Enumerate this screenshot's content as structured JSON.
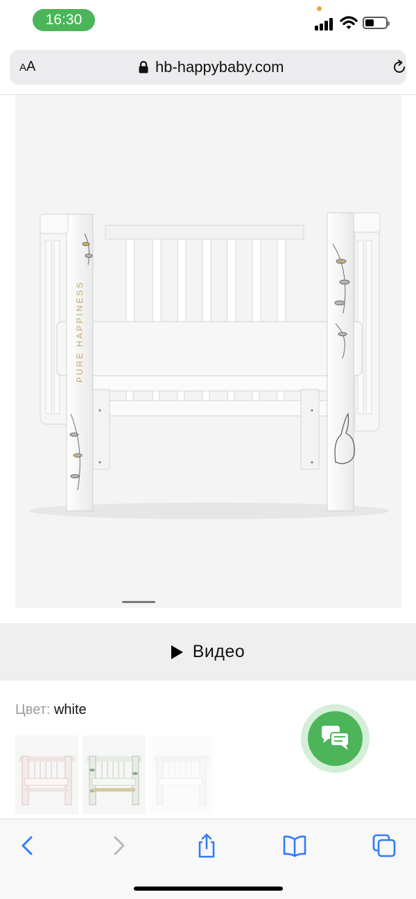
{
  "status_bar": {
    "time": "16:30"
  },
  "browser": {
    "url": "hb-happybaby.com",
    "text_size_label": "AA"
  },
  "product": {
    "crib_print_text": "PURE HAPPINESS",
    "video_label": "Видео",
    "color_label": "Цвет:",
    "color_value": "white",
    "thumbnails": [
      "pink",
      "green",
      "white"
    ],
    "selected_thumbnail": "white"
  },
  "colors": {
    "accent_green": "#4cb55a",
    "lock": "#111111",
    "toolbar_blue": "#2f7cf6"
  },
  "icons": [
    "lock-icon",
    "reload-icon",
    "play-icon",
    "chat-icon",
    "back-icon",
    "forward-icon",
    "share-icon",
    "bookmarks-icon",
    "tabs-icon"
  ]
}
